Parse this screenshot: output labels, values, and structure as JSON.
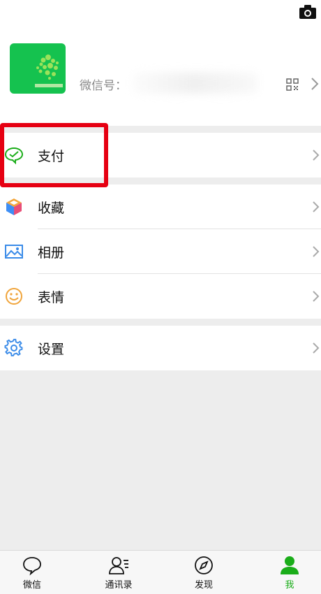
{
  "profile": {
    "wechat_id_label": "微信号："
  },
  "menu": {
    "pay": "支付",
    "favorites": "收藏",
    "album": "相册",
    "stickers": "表情",
    "settings": "设置"
  },
  "tabbar": {
    "chats": "微信",
    "contacts": "通讯录",
    "discover": "发现",
    "me": "我"
  },
  "colors": {
    "accent": "#1aad19",
    "highlight": "#e60012",
    "avatar_bg": "#15c24f"
  },
  "icons": [
    "camera-icon",
    "qr-code-icon",
    "chevron-right-icon",
    "wechat-pay-icon",
    "favorites-cube-icon",
    "album-icon",
    "smiley-icon",
    "gear-icon",
    "chat-bubble-icon",
    "contacts-icon",
    "compass-icon",
    "person-icon"
  ]
}
